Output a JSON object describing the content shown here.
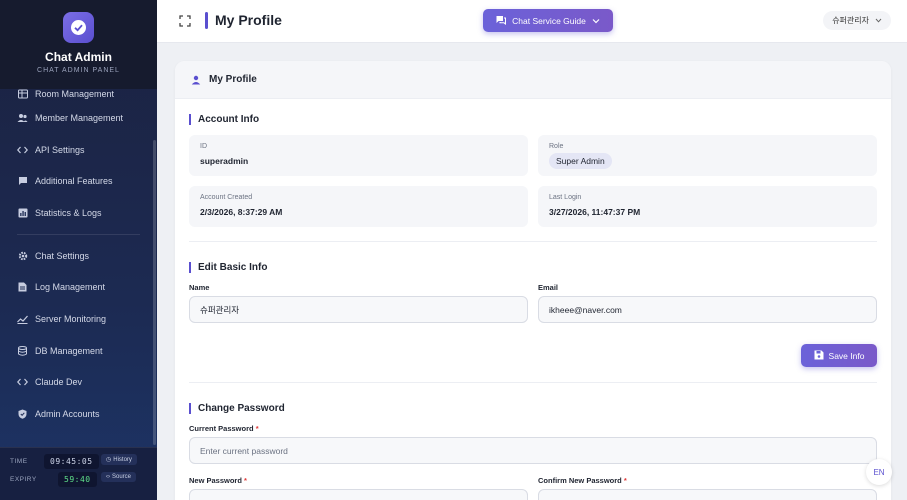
{
  "sidebar": {
    "brand_title": "Chat Admin",
    "brand_subtitle": "CHAT ADMIN PANEL",
    "items": [
      {
        "label": "Room Management",
        "icon": "table-icon"
      },
      {
        "label": "Member Management",
        "icon": "people-icon"
      },
      {
        "label": "API Settings",
        "icon": "code-icon"
      },
      {
        "label": "Additional Features",
        "icon": "chat-icon"
      },
      {
        "label": "Statistics & Logs",
        "icon": "chart-icon"
      },
      {
        "label": "Chat Settings",
        "icon": "gear-icon"
      },
      {
        "label": "Log Management",
        "icon": "document-icon"
      },
      {
        "label": "Server Monitoring",
        "icon": "line-chart-icon"
      },
      {
        "label": "DB Management",
        "icon": "database-icon"
      },
      {
        "label": "Claude Dev",
        "icon": "code-icon"
      },
      {
        "label": "Admin Accounts",
        "icon": "shield-icon"
      }
    ],
    "footer": {
      "time_label": "TIME",
      "time_value": "09:45:05",
      "history_label": "History",
      "expiry_label": "EXPIRY",
      "expiry_value": "59:40",
      "source_label": "Source"
    }
  },
  "header": {
    "title": "My Profile",
    "guide_button": "Chat Service Guide",
    "user_name": "슈퍼관리자"
  },
  "card": {
    "title": "My Profile",
    "account_info": {
      "title": "Account Info",
      "id_label": "ID",
      "id_value": "superadmin",
      "role_label": "Role",
      "role_value": "Super Admin",
      "created_label": "Account Created",
      "created_value": "2/3/2026, 8:37:29 AM",
      "last_login_label": "Last Login",
      "last_login_value": "3/27/2026, 11:47:37 PM"
    },
    "edit_basic": {
      "title": "Edit Basic Info",
      "name_label": "Name",
      "name_value": "슈퍼관리자",
      "email_label": "Email",
      "email_value": "ikheee@naver.com",
      "save_button": "Save Info"
    },
    "change_password": {
      "title": "Change Password",
      "current_label": "Current Password",
      "current_placeholder": "Enter current password",
      "new_label": "New Password",
      "confirm_label": "Confirm New Password",
      "required_mark": "*"
    }
  },
  "lang_button": "EN",
  "colors": {
    "accent": "#5a4fcf",
    "sidebar_bg": "#1c2a52"
  }
}
